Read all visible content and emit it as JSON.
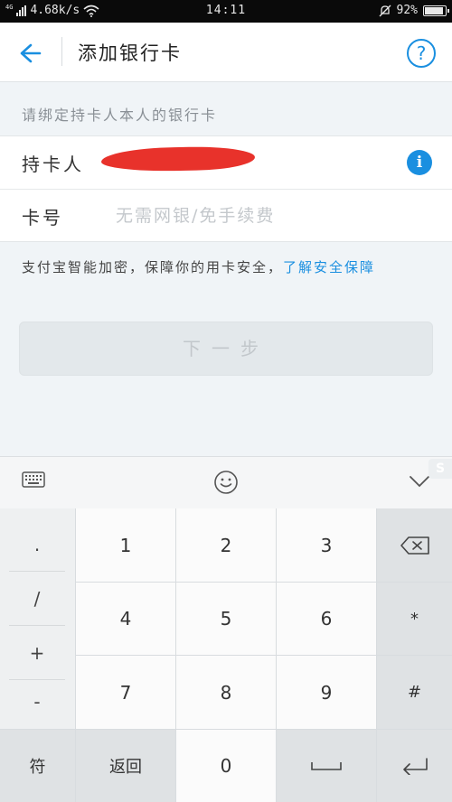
{
  "status_bar": {
    "network_type": "4G",
    "speed": "4.68k/s",
    "time": "14:11",
    "battery": "92%",
    "battery_level": 0.92
  },
  "header": {
    "title": "添加银行卡",
    "help": "?"
  },
  "hint": "请绑定持卡人本人的银行卡",
  "form": {
    "cardholder_label": "持卡人",
    "card_number_label": "卡号",
    "card_number_placeholder": "无需网银/免手续费",
    "card_number_value": ""
  },
  "notice": {
    "text": "支付宝智能加密，保障你的用卡安全，",
    "link": "了解安全保障"
  },
  "next_button": "下一步",
  "keyboard": {
    "symbols": [
      ".",
      "/",
      "+",
      "-"
    ],
    "digits": [
      "1",
      "2",
      "3",
      "4",
      "5",
      "6",
      "7",
      "8",
      "9",
      "0"
    ],
    "extra_keys": [
      "*",
      "#"
    ],
    "symbol_key": "符",
    "return_key": "返回",
    "icons": {
      "keyboard": "keyboard-icon",
      "emoji": "emoji-icon",
      "collapse": "chevron-down-icon",
      "backspace": "backspace-icon",
      "space": "space-icon",
      "enter": "enter-icon"
    }
  },
  "colors": {
    "accent": "#1a8fe0",
    "redaction": "#e8322b",
    "background": "#f0f4f7"
  }
}
